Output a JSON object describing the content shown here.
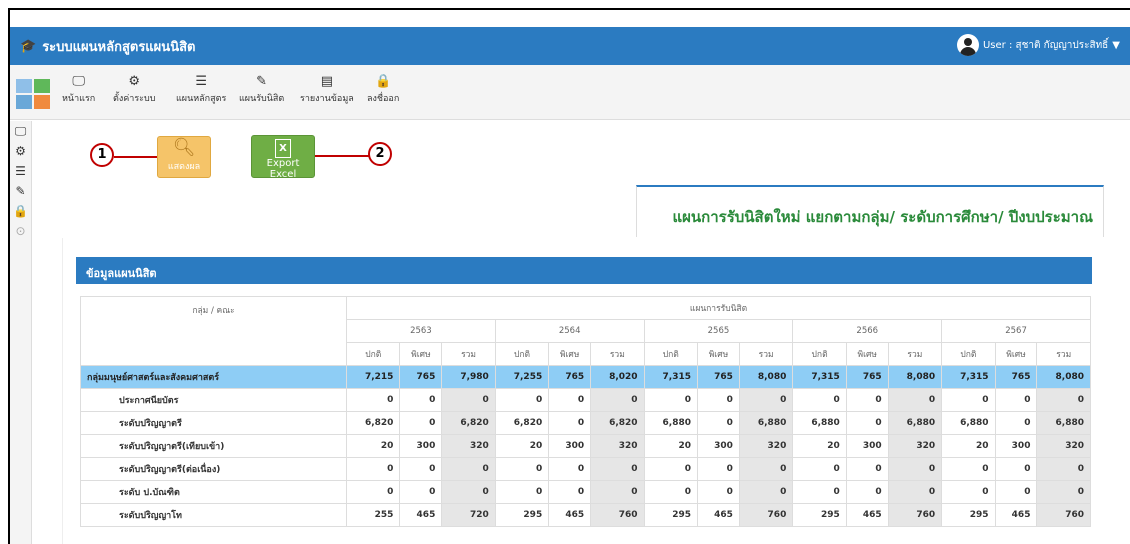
{
  "app": {
    "title": "ระบบแผนหลักสูตรแผนนิสิต",
    "user_label": "User : สุชาติ กัญญาประสิทธิ์"
  },
  "toolbar": {
    "items": [
      {
        "label": "หน้าแรก",
        "icon": "monitor-icon"
      },
      {
        "label": "ตั้งค่าระบบ",
        "icon": "gears-icon"
      },
      {
        "label": "แผนหลักสูตร",
        "icon": "list-icon"
      },
      {
        "label": "แผนรับนิสิต",
        "icon": "edit-icon"
      },
      {
        "label": "รายงานข้อมูล",
        "icon": "report-icon"
      },
      {
        "label": "ลงชื่ออก",
        "icon": "lock-icon"
      }
    ]
  },
  "actions": {
    "show_label": "แสดงผล",
    "excel_label": "Export Excel",
    "callout_1": "1",
    "callout_2": "2"
  },
  "report": {
    "title": "แผนการรับนิสิตใหม่ แยกตามกลุ่ม/ ระดับการศึกษา/ ปีงบประมาณ",
    "panel_title": "ข้อมูลแผนนิสิต"
  },
  "table": {
    "group_header": "กลุ่ม / คณะ",
    "plan_header": "แผนการรับนิสิต",
    "years": [
      "2563",
      "2564",
      "2565",
      "2566",
      "2567"
    ],
    "sub_headers": [
      "ปกติ",
      "พิเศษ",
      "รวม"
    ],
    "rows": [
      {
        "name": "กลุ่มมนุษย์ศาสตร์และสังคมศาสตร์",
        "group": true,
        "values": [
          "7,215",
          "765",
          "7,980",
          "7,255",
          "765",
          "8,020",
          "7,315",
          "765",
          "8,080",
          "7,315",
          "765",
          "8,080",
          "7,315",
          "765",
          "8,080"
        ]
      },
      {
        "name": "ประกาศนียบัตร",
        "group": false,
        "values": [
          "0",
          "0",
          "0",
          "0",
          "0",
          "0",
          "0",
          "0",
          "0",
          "0",
          "0",
          "0",
          "0",
          "0",
          "0"
        ]
      },
      {
        "name": "ระดับปริญญาตรี",
        "group": false,
        "values": [
          "6,820",
          "0",
          "6,820",
          "6,820",
          "0",
          "6,820",
          "6,880",
          "0",
          "6,880",
          "6,880",
          "0",
          "6,880",
          "6,880",
          "0",
          "6,880"
        ]
      },
      {
        "name": "ระดับปริญญาตรี(เทียบเข้า)",
        "group": false,
        "values": [
          "20",
          "300",
          "320",
          "20",
          "300",
          "320",
          "20",
          "300",
          "320",
          "20",
          "300",
          "320",
          "20",
          "300",
          "320"
        ]
      },
      {
        "name": "ระดับปริญญาตรี(ต่อเนื่อง)",
        "group": false,
        "values": [
          "0",
          "0",
          "0",
          "0",
          "0",
          "0",
          "0",
          "0",
          "0",
          "0",
          "0",
          "0",
          "0",
          "0",
          "0"
        ]
      },
      {
        "name": "ระดับ ป.บัณฑิต",
        "group": false,
        "values": [
          "0",
          "0",
          "0",
          "0",
          "0",
          "0",
          "0",
          "0",
          "0",
          "0",
          "0",
          "0",
          "0",
          "0",
          "0"
        ]
      },
      {
        "name": "ระดับปริญญาโท",
        "group": false,
        "values": [
          "255",
          "465",
          "720",
          "295",
          "465",
          "760",
          "295",
          "465",
          "760",
          "295",
          "465",
          "760",
          "295",
          "465",
          "760"
        ]
      }
    ]
  },
  "colors": {
    "topbar": "#2b7bc1",
    "group_row": "#8ecdf5",
    "sum_cell": "#e6e6e6",
    "title_green": "#2a8a3a",
    "callout_red": "#c00000"
  }
}
